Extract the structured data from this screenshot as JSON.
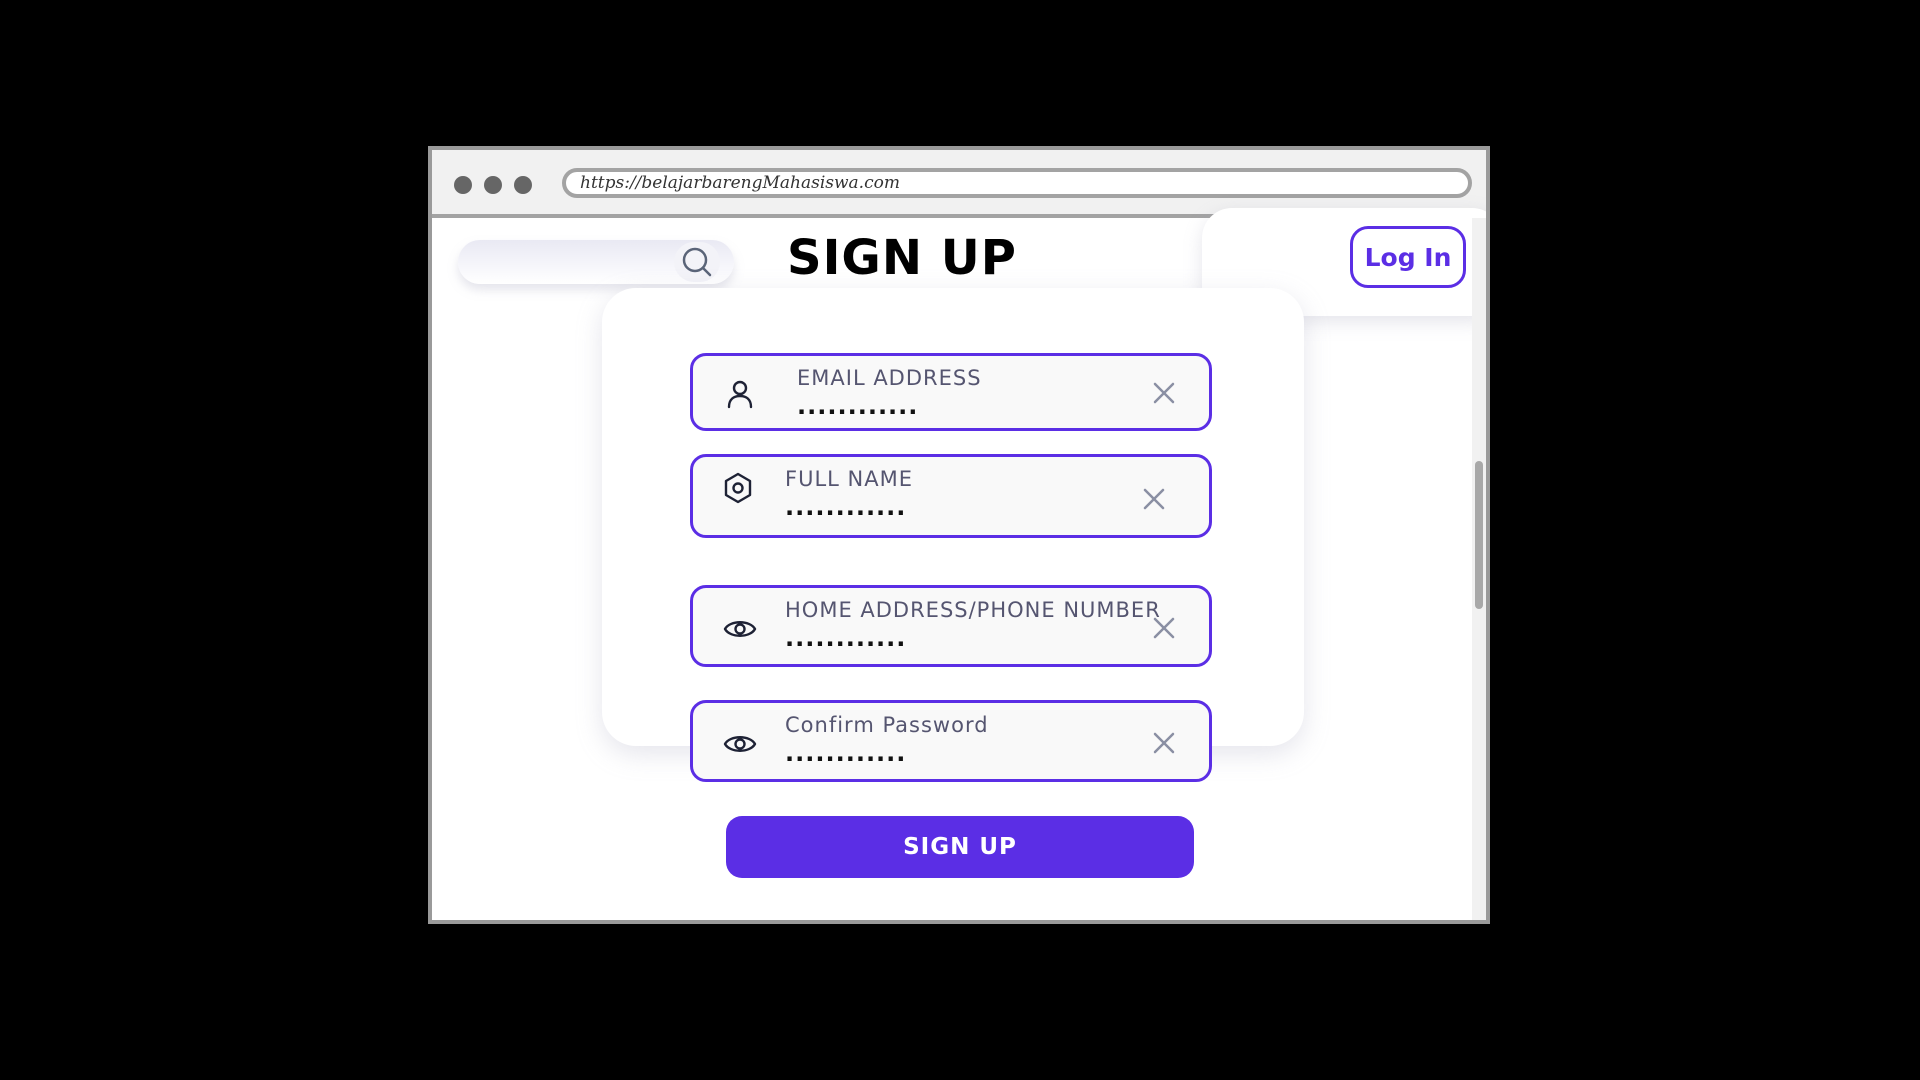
{
  "browser": {
    "url": "https://belajarbarengMahasiswa.com"
  },
  "header": {
    "title": "SIGN UP",
    "login_label": "Log In"
  },
  "form": {
    "fields": [
      {
        "label": "EMAIL ADDRESS",
        "value": "............",
        "icon": "user-icon"
      },
      {
        "label": "FULL NAME",
        "value": "............",
        "icon": "hexagon-settings-icon"
      },
      {
        "label": "HOME ADDRESS/PHONE NUMBER",
        "value": "............",
        "icon": "eye-icon"
      },
      {
        "label": "Confirm Password",
        "value": "............",
        "icon": "eye-icon"
      }
    ],
    "submit_label": "SIGN UP"
  },
  "colors": {
    "accent": "#5b2ee5",
    "background": "#000000",
    "label": "#555570"
  }
}
